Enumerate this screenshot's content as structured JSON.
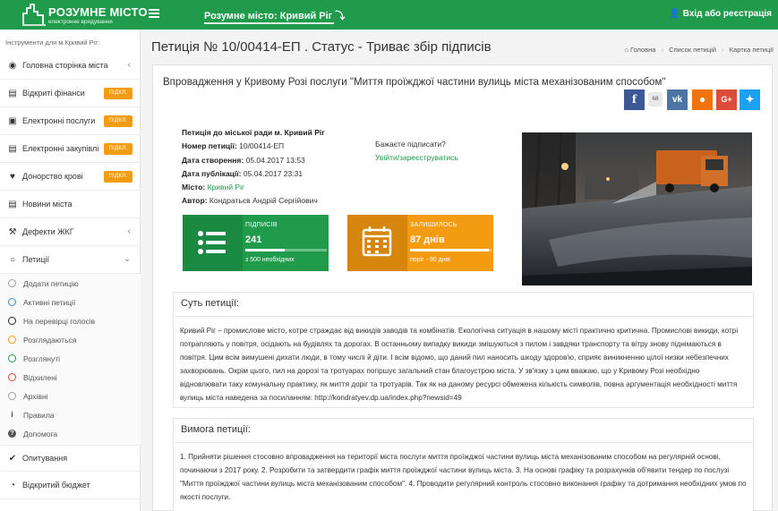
{
  "app": {
    "logo_title": "РОЗУМНЕ МІСТО",
    "logo_subtitle": "електронне врядування",
    "city_selector": "Розумне місто: Кривий Ріг ⤵",
    "login": "Вхід або реєстрація"
  },
  "colors": {
    "brand_green": "#1f9b4b",
    "badge_orange": "#f39c12",
    "stat_green": "#1f9b4b",
    "stat_orange": "#f39c12"
  },
  "sidebar": {
    "heading": "Інструменти для м.Кривий Ріг:",
    "items": [
      {
        "label": "Головна сторінка міста",
        "icon": "palette-icon",
        "chevron": "‹"
      },
      {
        "label": "Відкриті фінанси",
        "icon": "card-icon",
        "badge": "ПІДКЛ."
      },
      {
        "label": "Електронні послуги",
        "icon": "briefcase-icon",
        "badge": "ПІДКЛ."
      },
      {
        "label": "Електронні закупівлі",
        "icon": "cart-icon",
        "badge": "ПІДКЛ."
      },
      {
        "label": "Донорство крові",
        "icon": "heart-icon",
        "badge": "ПІДКЛ."
      },
      {
        "label": "Новини міста",
        "icon": "newspaper-icon"
      },
      {
        "label": "Дефекти ЖКГ",
        "icon": "wrench-icon",
        "chevron": "‹"
      },
      {
        "label": "Петиції",
        "icon": "comment-icon",
        "chevron": "⌄"
      }
    ],
    "petition_subitems": [
      {
        "label": "Додати петицію",
        "icon": "plus-circle-icon",
        "color": "#9e9e9e"
      },
      {
        "label": "Активні петиції",
        "icon": "circle-icon",
        "color": "#3c8dbc"
      },
      {
        "label": "На перевірці голосів",
        "icon": "circle-icon",
        "color": "#222222"
      },
      {
        "label": "Розглядаються",
        "icon": "circle-icon",
        "color": "#f39c12"
      },
      {
        "label": "Розглянуті",
        "icon": "circle-icon",
        "color": "#1f9b4b"
      },
      {
        "label": "Відхилені",
        "icon": "circle-icon",
        "color": "#dd4b39"
      },
      {
        "label": "Архівні",
        "icon": "circle-icon",
        "color": "#9e9e9e"
      },
      {
        "label": "Правила",
        "icon": "info-icon",
        "color": "#555555"
      },
      {
        "label": "Допомога",
        "icon": "question-icon",
        "color": "#555555"
      }
    ],
    "bottom_items": [
      {
        "label": "Опитування",
        "icon": "check-icon"
      },
      {
        "label": "Відкритий бюджет",
        "icon": "pie-chart-icon"
      }
    ]
  },
  "page": {
    "title": "Петиція № 10/00414-ЕП . Статус - Триває збір підписів",
    "breadcrumbs": [
      "Головна",
      "Список петицій",
      "Картка петиції"
    ]
  },
  "petition": {
    "heading": "Впровадження у Кривому Розі послуги \"Миття проїжджої частини вулиць міста механізованим способом\"",
    "share_count": "68",
    "info": {
      "to_label": "Петиція до міської ради м. Кривий Ріг",
      "number_label": "Номер петиції:",
      "number": "10/00414-ЕП",
      "created_label": "Дата створення:",
      "created": "05.04.2017 13:53",
      "published_label": "Дата публікації:",
      "published": "05.04.2017 23:31",
      "city_label": "Місто:",
      "city": "Кривий Ріг",
      "author_label": "Автор:",
      "author": "Кондратьєв Андрій Сергійович"
    },
    "sign_question": "Бажаєте підписати?",
    "sign_link": "Увійти/зареєструватись",
    "signatures": {
      "label": "ПІДПИСІВ",
      "value": "241",
      "needed": "з 500 необхідних",
      "progress": 0.48
    },
    "remaining": {
      "label": "ЗАЛИШИЛОСЬ",
      "value": "87 днів",
      "threshold": "поріг - 90 днів",
      "progress": 0.97
    },
    "essence": {
      "title": "Суть петиції:",
      "text": "Кривий Ріг – промислове місто, котре страждає від викидів заводів та комбінатів. Екологічна ситуація в нашому місті практично критична. Промислові викиди, котрі потрапляють у повітря, осідають на будівлях та дорогах. В останньому випадку викиди змішуються з пилом і завдяки транспорту та вітру знову піднімаються в повітря. Цим всім вимушені дихати люди, в тому числі й діти. І всім відомо, що даний пил наносить шкоду здоров'ю, сприяє виникненню цілої низки небезпечних захворювань. Окрім цього, пил на дорозі та тротуарах погіршує загальний стан благоустрою міста. У зв'язку з цим вважаю, що у Кривому Розі необхідно відновлювати таку комунальну практику, як миття доріг та тротуарів. Так як на даному ресурсі обмежена кількість символів, повна аргументація необхідності миття вулиць міста наведена за посиланням: http://kondratyev.dp.ua/index.php?newsid=49"
    },
    "demand": {
      "title": "Вимога петиції:",
      "text": "1. Прийняти рішення стосовно впровадження на території міста послуги миття проїжджої частини вулиць міста механізованим способом на регулярній основі, починаючи з 2017 року. 2. Розробити та затвердити графік миття проїжджої частини вулиць міста. 3. На основі графіку та розрахунків об'явити тендер по послузі \"Миття проїжджої частини вулиць міста механізованим способом\". 4. Проводити регулярний контроль стосовно виконання графіку та дотримання необхідних умов по якості послуги."
    }
  }
}
